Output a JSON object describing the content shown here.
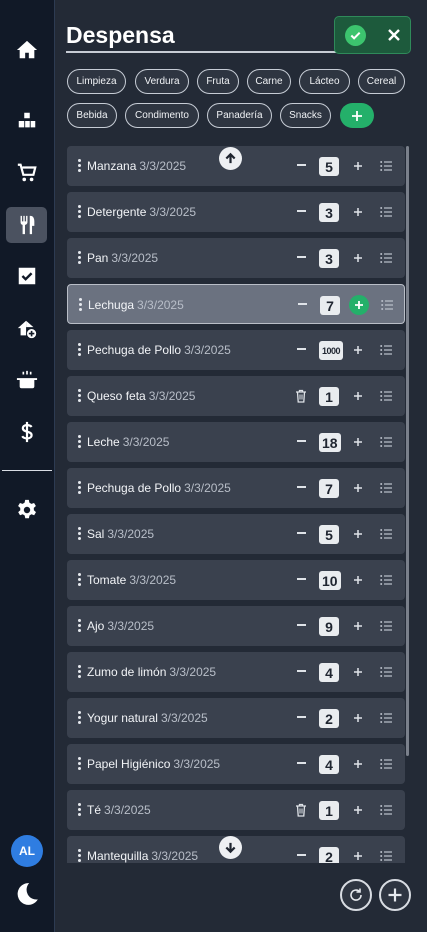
{
  "header": {
    "title": "Despensa"
  },
  "sidebar": {
    "items": [
      {
        "icon": "home-icon"
      },
      {
        "icon": "boxes-icon"
      },
      {
        "icon": "cart-icon"
      },
      {
        "icon": "utensils-icon",
        "active": true
      },
      {
        "icon": "checkbox-icon"
      },
      {
        "icon": "home-plus-icon"
      },
      {
        "icon": "pot-icon"
      },
      {
        "icon": "dollar-icon"
      },
      {
        "icon": "gear-icon"
      }
    ],
    "user_initials": "AL"
  },
  "categories": [
    "Limpieza",
    "Verdura",
    "Fruta",
    "Carne",
    "Lácteo",
    "Cereal",
    "Bebida",
    "Condimento",
    "Panadería",
    "Snacks"
  ],
  "items": [
    {
      "name": "Manzana",
      "date": "3/3/2025",
      "qty": "5"
    },
    {
      "name": "Detergente",
      "date": "3/3/2025",
      "qty": "3"
    },
    {
      "name": "Pan",
      "date": "3/3/2025",
      "qty": "3"
    },
    {
      "name": "Lechuga",
      "date": "3/3/2025",
      "qty": "7"
    },
    {
      "name": "Pechuga de Pollo",
      "date": "3/3/2025",
      "qty": "1000"
    },
    {
      "name": "Queso feta",
      "date": "3/3/2025",
      "qty": "1"
    },
    {
      "name": "Leche",
      "date": "3/3/2025",
      "qty": "18"
    },
    {
      "name": "Pechuga de Pollo",
      "date": "3/3/2025",
      "qty": "7"
    },
    {
      "name": "Sal",
      "date": "3/3/2025",
      "qty": "5"
    },
    {
      "name": "Tomate",
      "date": "3/3/2025",
      "qty": "10"
    },
    {
      "name": "Ajo",
      "date": "3/3/2025",
      "qty": "9"
    },
    {
      "name": "Zumo de limón",
      "date": "3/3/2025",
      "qty": "4"
    },
    {
      "name": "Yogur natural",
      "date": "3/3/2025",
      "qty": "2"
    },
    {
      "name": "Papel Higiénico",
      "date": "3/3/2025",
      "qty": "4"
    },
    {
      "name": "Té",
      "date": "3/3/2025",
      "qty": "1"
    },
    {
      "name": "Mantequilla",
      "date": "3/3/2025",
      "qty": "2"
    }
  ],
  "colors": {
    "accent_green": "#24b06a",
    "row_bg": "#3a414e",
    "sidebar_bg": "#111927",
    "avatar_blue": "#2f7de1"
  }
}
